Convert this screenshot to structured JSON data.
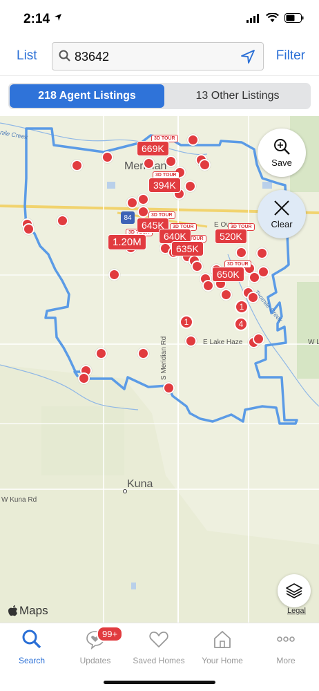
{
  "status": {
    "time": "2:14"
  },
  "nav": {
    "list_label": "List",
    "filter_label": "Filter",
    "search_value": "83642"
  },
  "segment": {
    "agent_listings": "218 Agent Listings",
    "other_listings": "13 Other Listings"
  },
  "map": {
    "save_label": "Save",
    "clear_label": "Clear",
    "legal_label": "Legal",
    "provider": "Maps",
    "places": {
      "meridian": "Meridian",
      "kuna": "Kuna"
    },
    "roads": {
      "e_lake_hazel": "E Lake Haze",
      "w_l": "W L",
      "s_meridian_rd": "S Meridian Rd",
      "w_kuna_rd": "W Kuna Rd",
      "e_overland": "E Ove",
      "interstate": "84"
    },
    "creeks": {
      "ten_mile": "Tenmile Creek",
      "five_mile": "nile Creek"
    },
    "tour_tag": "3D TOUR",
    "prices": [
      "669K",
      "394K",
      "645K",
      "640K",
      "1.20M",
      "635K",
      "520K",
      "650K"
    ],
    "cluster_counts": [
      "1",
      "1",
      "4"
    ]
  },
  "tabs": [
    {
      "label": "Search",
      "icon": "search-icon"
    },
    {
      "label": "Updates",
      "icon": "heart-chat-icon",
      "badge": "99+"
    },
    {
      "label": "Saved Homes",
      "icon": "heart-icon"
    },
    {
      "label": "Your Home",
      "icon": "house-icon"
    },
    {
      "label": "More",
      "icon": "more-dots-icon"
    }
  ],
  "colors": {
    "accent": "#2f73d9",
    "pin": "#e13b3f",
    "boundary": "#5b9be6"
  }
}
